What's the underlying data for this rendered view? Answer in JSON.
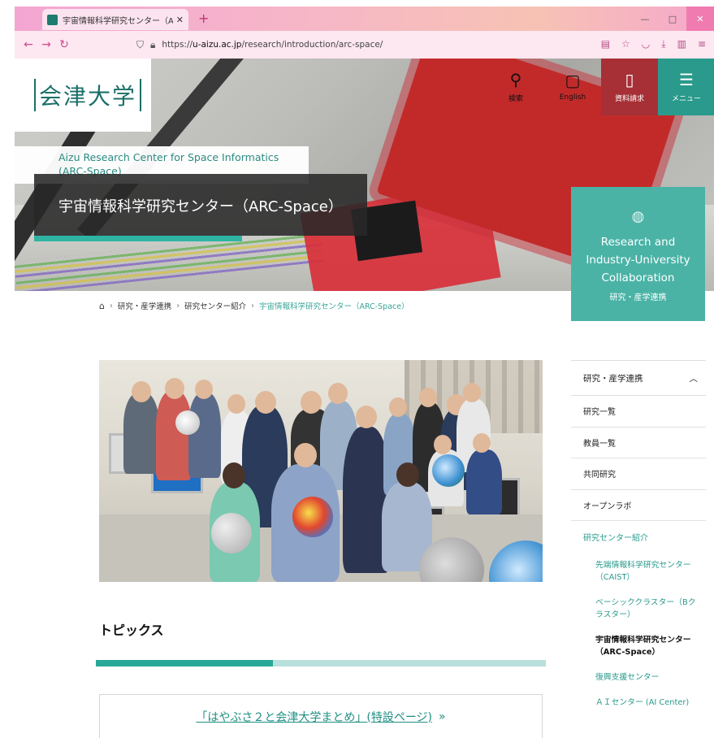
{
  "browser": {
    "tab_title": "宇宙情報科学研究センター（ARC",
    "tab_close": "✕",
    "new_tab": "+",
    "url_prefix": "https://",
    "url_host": "u-aizu.ac.jp",
    "url_path": "/research/introduction/arc-space/"
  },
  "header": {
    "logo": "会津大学",
    "search_label": "検索",
    "english_label": "English",
    "request_label": "資料請求",
    "menu_label": "メニュー"
  },
  "hero": {
    "center_en_line1": "Aizu Research Center for Space Informatics",
    "center_en_line2": "(ARC-Space)",
    "center_jp": "宇宙情報科学研究センター（ARC-Space）",
    "collab_en_line1": "Research and",
    "collab_en_line2": "Industry-University",
    "collab_en_line3": "Collaboration",
    "collab_jp": "研究・産学連携"
  },
  "breadcrumb": {
    "items": [
      "研究・産学連携",
      "研究センター紹介"
    ],
    "current": "宇宙情報科学研究センター（ARC-Space）"
  },
  "topics": {
    "title": "トピックス",
    "link": "「はやぶさ２と会津大学まとめ」(特設ページ)",
    "link_arrow": "»"
  },
  "sidebar": {
    "head": "研究・産学連携",
    "items": [
      "研究一覧",
      "教員一覧",
      "共同研究",
      "オープンラボ"
    ],
    "active": "研究センター紹介",
    "subs": [
      "先端情報科学研究センター（CAIST）",
      "ベーシッククラスター（Bクラスター）",
      "宇宙情報科学研究センター（ARC-Space）",
      "復興支援センター",
      "ＡＩセンター (AI Center)"
    ]
  },
  "colors": {
    "teal": "#2a9a8c",
    "red": "#a63036",
    "accent_light": "#b8e0dc"
  }
}
